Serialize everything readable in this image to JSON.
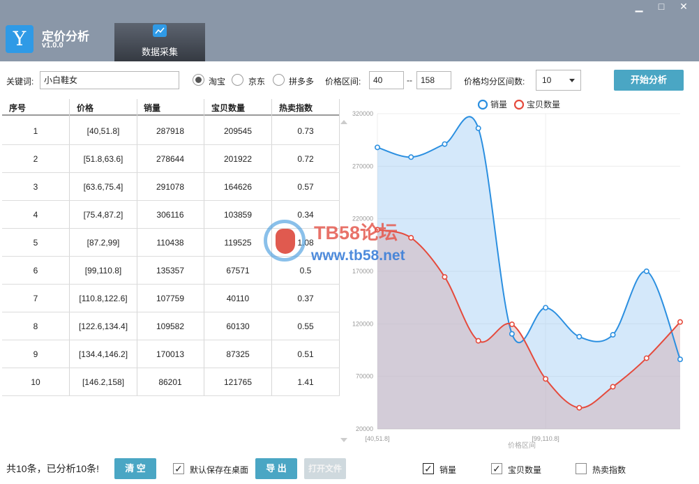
{
  "app": {
    "logo_glyph": "Y",
    "title": "定价分析",
    "version": "v1.0.0",
    "tab_label": "数据采集",
    "minimize": "▁",
    "maximize": "□",
    "close": "✕"
  },
  "toolbar": {
    "keyword_label": "关键词:",
    "keyword_value": "小白鞋女",
    "platforms": [
      {
        "label": "淘宝",
        "checked": true
      },
      {
        "label": "京东",
        "checked": false
      },
      {
        "label": "拼多多",
        "checked": false
      }
    ],
    "price_range_label": "价格区间:",
    "price_min": "40",
    "price_dash": "--",
    "price_max": "158",
    "intervals_label": "价格均分区间数:",
    "intervals_value": "10",
    "start_button": "开始分析"
  },
  "table": {
    "headers": [
      "序号",
      "价格",
      "销量",
      "宝贝数量",
      "热卖指数"
    ],
    "rows": [
      [
        "1",
        "[40,51.8]",
        "287918",
        "209545",
        "0.73"
      ],
      [
        "2",
        "[51.8,63.6]",
        "278644",
        "201922",
        "0.72"
      ],
      [
        "3",
        "[63.6,75.4]",
        "291078",
        "164626",
        "0.57"
      ],
      [
        "4",
        "[75.4,87.2]",
        "306116",
        "103859",
        "0.34"
      ],
      [
        "5",
        "[87.2,99]",
        "110438",
        "119525",
        "1.08"
      ],
      [
        "6",
        "[99,110.8]",
        "135357",
        "67571",
        "0.5"
      ],
      [
        "7",
        "[110.8,122.6]",
        "107759",
        "40110",
        "0.37"
      ],
      [
        "8",
        "[122.6,134.4]",
        "109582",
        "60130",
        "0.55"
      ],
      [
        "9",
        "[134.4,146.2]",
        "170013",
        "87325",
        "0.51"
      ],
      [
        "10",
        "[146.2,158]",
        "86201",
        "121765",
        "1.41"
      ]
    ]
  },
  "chart_data": {
    "type": "area",
    "categories": [
      "[40,51.8]",
      "[51.8,63.6]",
      "[63.6,75.4]",
      "[75.4,87.2]",
      "[87.2,99]",
      "[99,110.8]",
      "[110.8,122.6]",
      "[122.6,134.4]",
      "[134.4,146.2]",
      "[146.2,158]"
    ],
    "x_tick_labels": [
      "[40,51.8]",
      "[99,110.8]"
    ],
    "xlabel": "价格区间",
    "ylabel": "",
    "ylim": [
      20000,
      320000
    ],
    "y_ticks": [
      20000,
      70000,
      120000,
      170000,
      220000,
      270000,
      320000
    ],
    "legend_position": "top",
    "grid": true,
    "series": [
      {
        "name": "销量",
        "color": "#2b8fe0",
        "values": [
          287918,
          278644,
          291078,
          306116,
          110438,
          135357,
          107759,
          109582,
          170013,
          86201
        ]
      },
      {
        "name": "宝贝数量",
        "color": "#e54a3c",
        "values": [
          209545,
          201922,
          164626,
          103859,
          119525,
          67571,
          40110,
          60130,
          87325,
          121765
        ]
      }
    ]
  },
  "footer": {
    "summary": "共10条，已分析10条!",
    "clear_button": "清 空",
    "save_desktop_label": "默认保存在桌面",
    "export_button": "导 出",
    "open_file_button": "打开文件",
    "series_toggles": [
      {
        "label": "销量",
        "checked": true
      },
      {
        "label": "宝贝数量",
        "checked": true
      },
      {
        "label": "热卖指数",
        "checked": false
      }
    ]
  },
  "watermark": {
    "line1": "TB58论坛",
    "line2": "www.tb58.net"
  }
}
